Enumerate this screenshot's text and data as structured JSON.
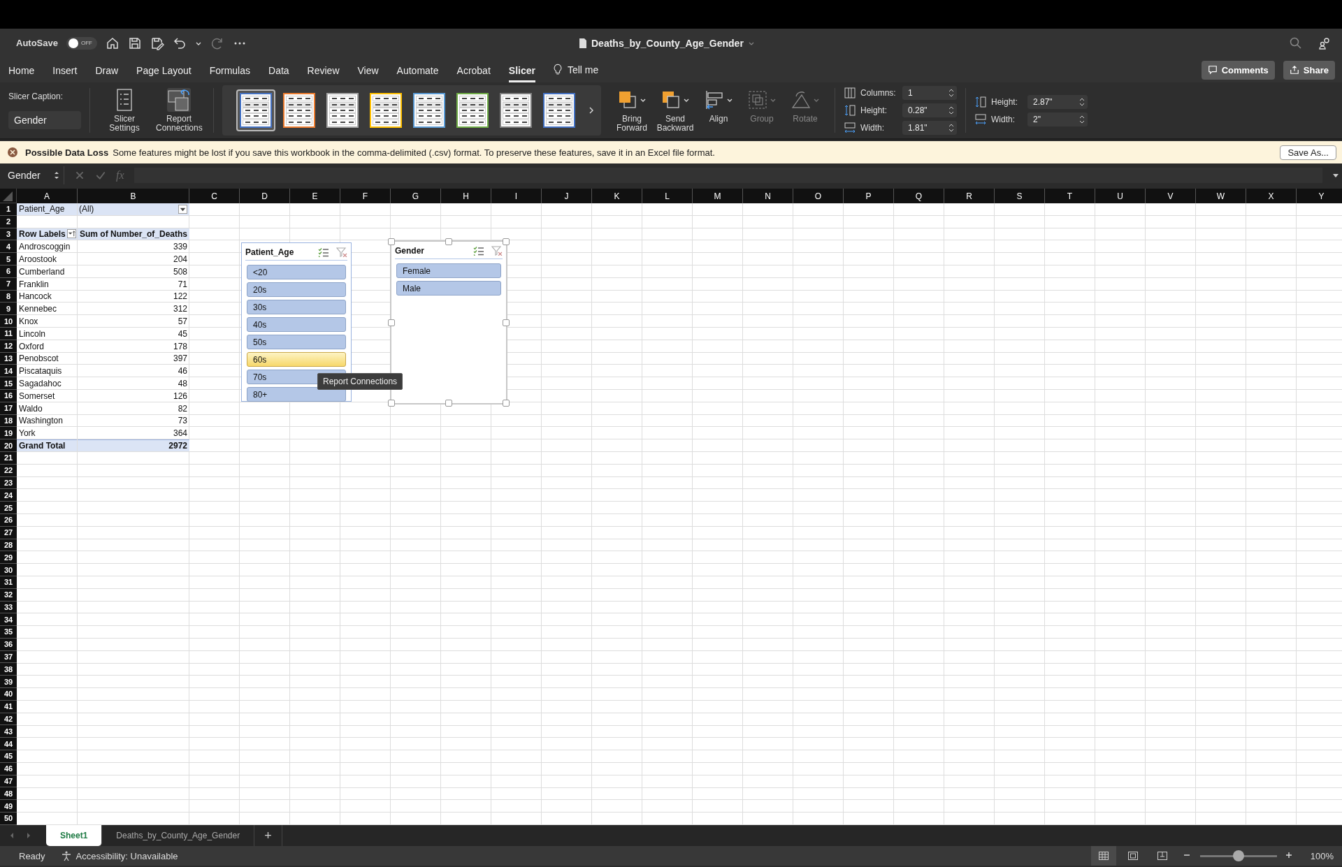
{
  "title_bar": {
    "autosave_label": "AutoSave",
    "autosave": {
      "on": false,
      "label": "OFF"
    },
    "title": "Deaths_by_County_Age_Gender"
  },
  "ribbon_tabs": [
    {
      "label": "Home",
      "selected": false
    },
    {
      "label": "Insert",
      "selected": false
    },
    {
      "label": "Draw",
      "selected": false
    },
    {
      "label": "Page Layout",
      "selected": false
    },
    {
      "label": "Formulas",
      "selected": false
    },
    {
      "label": "Data",
      "selected": false
    },
    {
      "label": "Review",
      "selected": false
    },
    {
      "label": "View",
      "selected": false
    },
    {
      "label": "Automate",
      "selected": false
    },
    {
      "label": "Acrobat",
      "selected": false
    },
    {
      "label": "Slicer",
      "selected": true
    }
  ],
  "tell_me": "Tell me",
  "comments_button": "Comments",
  "share_button": "Share",
  "ribbon": {
    "caption_label": "Slicer Caption:",
    "caption_value": "Gender",
    "tool_buttons": [
      {
        "label": "Slicer Settings",
        "kind": "settings"
      },
      {
        "label": "Report Connections",
        "kind": "connections"
      }
    ],
    "styles": [
      {
        "color": "#4472c4",
        "selected": true
      },
      {
        "color": "#ed7d31",
        "selected": false
      },
      {
        "color": "#a5a5a5",
        "selected": false
      },
      {
        "color": "#ffc000",
        "selected": false
      },
      {
        "color": "#5b9bd5",
        "selected": false
      },
      {
        "color": "#70ad47",
        "selected": false
      },
      {
        "color": "#7f7f7f",
        "selected": false
      },
      {
        "color": "#4472c4",
        "selected": false
      }
    ],
    "arrange": [
      {
        "label": "Bring Forward",
        "kind": "forward",
        "disabled": false
      },
      {
        "label": "Send Backward",
        "kind": "backward",
        "disabled": false
      },
      {
        "label": "Align",
        "kind": "align",
        "disabled": false
      },
      {
        "label": "Group",
        "kind": "group",
        "disabled": true
      },
      {
        "label": "Rotate",
        "kind": "rotate",
        "disabled": true
      }
    ],
    "button_size": [
      {
        "label": "Columns:",
        "value": "1",
        "kind": "columns"
      },
      {
        "label": "Height:",
        "value": "0.28\"",
        "kind": "height"
      },
      {
        "label": "Width:",
        "value": "1.81\"",
        "kind": "width"
      }
    ],
    "slicer_size": [
      {
        "label": "Height:",
        "value": "2.87\"",
        "kind": "height"
      },
      {
        "label": "Width:",
        "value": "2\"",
        "kind": "width"
      }
    ]
  },
  "message_bar": {
    "title": "Possible Data Loss",
    "text": "Some features might be lost if you save this workbook in the comma-delimited (.csv) format. To preserve these features, save it in an Excel file format.",
    "button": "Save As..."
  },
  "formula_bar": {
    "name_box": "Gender",
    "fx": "fx"
  },
  "sheet": {
    "columns": [
      "A",
      "B",
      "C",
      "D",
      "E",
      "F",
      "G",
      "H",
      "I",
      "J",
      "K",
      "L",
      "M",
      "N",
      "O",
      "P",
      "Q",
      "R",
      "S",
      "T",
      "U",
      "V",
      "W",
      "X",
      "Y"
    ],
    "rows": [
      {
        "number": "1",
        "kind": "filter",
        "label": "Patient_Age",
        "value": "(All)"
      },
      {
        "number": "2"
      },
      {
        "number": "3",
        "kind": "header",
        "label": "Row Labels",
        "value": "Sum of Number_of_Deaths"
      },
      {
        "number": "4",
        "kind": "item",
        "label": "Androscoggin",
        "value": "339"
      },
      {
        "number": "5",
        "kind": "item",
        "label": "Aroostook",
        "value": "204"
      },
      {
        "number": "6",
        "kind": "item",
        "label": "Cumberland",
        "value": "508"
      },
      {
        "number": "7",
        "kind": "item",
        "label": "Franklin",
        "value": "71"
      },
      {
        "number": "8",
        "kind": "item",
        "label": "Hancock",
        "value": "122"
      },
      {
        "number": "9",
        "kind": "item",
        "label": "Kennebec",
        "value": "312"
      },
      {
        "number": "10",
        "kind": "item",
        "label": "Knox",
        "value": "57"
      },
      {
        "number": "11",
        "kind": "item",
        "label": "Lincoln",
        "value": "45"
      },
      {
        "number": "12",
        "kind": "item",
        "label": "Oxford",
        "value": "178"
      },
      {
        "number": "13",
        "kind": "item",
        "label": "Penobscot",
        "value": "397"
      },
      {
        "number": "14",
        "kind": "item",
        "label": "Piscataquis",
        "value": "46"
      },
      {
        "number": "15",
        "kind": "item",
        "label": "Sagadahoc",
        "value": "48"
      },
      {
        "number": "16",
        "kind": "item",
        "label": "Somerset",
        "value": "126"
      },
      {
        "number": "17",
        "kind": "item",
        "label": "Waldo",
        "value": "82"
      },
      {
        "number": "18",
        "kind": "item",
        "label": "Washington",
        "value": "73"
      },
      {
        "number": "19",
        "kind": "item",
        "label": "York",
        "value": "364"
      },
      {
        "number": "20",
        "kind": "total",
        "label": "Grand Total",
        "value": "2972"
      },
      {
        "number": "21"
      },
      {
        "number": "22"
      },
      {
        "number": "23"
      },
      {
        "number": "24"
      },
      {
        "number": "25"
      },
      {
        "number": "26"
      },
      {
        "number": "27"
      },
      {
        "number": "28"
      },
      {
        "number": "29"
      },
      {
        "number": "30"
      },
      {
        "number": "31"
      },
      {
        "number": "32"
      },
      {
        "number": "33"
      },
      {
        "number": "34"
      },
      {
        "number": "35"
      },
      {
        "number": "36"
      },
      {
        "number": "37"
      },
      {
        "number": "38"
      },
      {
        "number": "39"
      },
      {
        "number": "40"
      },
      {
        "number": "41"
      },
      {
        "number": "42"
      },
      {
        "number": "43"
      },
      {
        "number": "44"
      },
      {
        "number": "45"
      },
      {
        "number": "46"
      },
      {
        "number": "47"
      },
      {
        "number": "48"
      },
      {
        "number": "49"
      },
      {
        "number": "50"
      }
    ]
  },
  "slicers": [
    {
      "title": "Patient_Age",
      "active": false,
      "items": [
        {
          "label": "<20",
          "selected": true,
          "hovered": false
        },
        {
          "label": "20s",
          "selected": true,
          "hovered": false
        },
        {
          "label": "30s",
          "selected": true,
          "hovered": false
        },
        {
          "label": "40s",
          "selected": true,
          "hovered": false
        },
        {
          "label": "50s",
          "selected": true,
          "hovered": false
        },
        {
          "label": "60s",
          "selected": true,
          "hovered": true
        },
        {
          "label": "70s",
          "selected": true,
          "hovered": false
        },
        {
          "label": "80+",
          "selected": true,
          "hovered": false
        }
      ]
    },
    {
      "title": "Gender",
      "active": true,
      "items": [
        {
          "label": "Female",
          "selected": true,
          "hovered": false
        },
        {
          "label": "Male",
          "selected": true,
          "hovered": false
        }
      ]
    }
  ],
  "tooltip": "Report Connections",
  "sheet_tabs": [
    {
      "label": "Sheet1",
      "selected": true
    },
    {
      "label": "Deaths_by_County_Age_Gender",
      "selected": false
    }
  ],
  "add_sheet": "+",
  "status_bar": {
    "status": "Ready",
    "accessibility": "Accessibility: Unavailable",
    "zoom_slider": {
      "level": 0.5
    },
    "zoom": "100%"
  }
}
